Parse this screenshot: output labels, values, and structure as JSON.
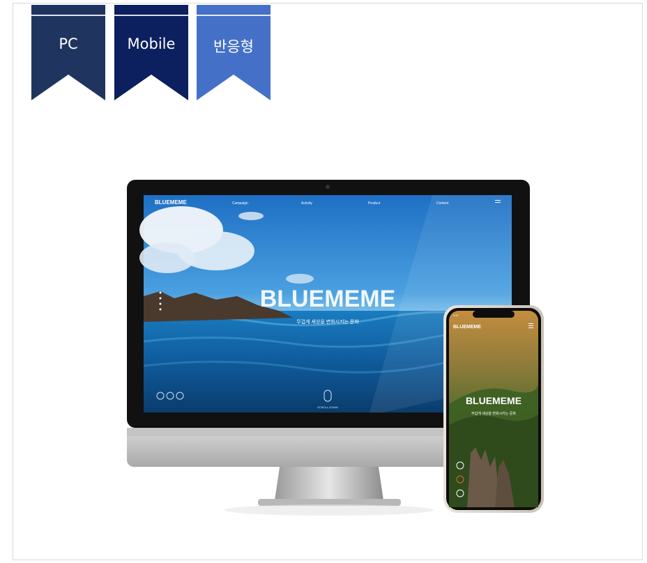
{
  "tabs": [
    {
      "label": "PC",
      "color": "#1f3560"
    },
    {
      "label": "Mobile",
      "color": "#0c1f5e"
    },
    {
      "label": "반응형",
      "color": "#4570c7"
    }
  ],
  "desktop": {
    "logo": "BLUEMEME",
    "nav": [
      "Campaign",
      "Activity",
      "Product",
      "Content"
    ],
    "hero_title": "BLUEMEME",
    "hero_subtitle": "무겁게 세상을 변화시키는 문화",
    "scroll_label": "SCROLL DOWN"
  },
  "mobile": {
    "time": "9:41",
    "logo": "BLUEMEME",
    "hero_title": "BLUEMEME",
    "hero_subtitle": "무겁게 세상을 변화시키는 문화"
  }
}
